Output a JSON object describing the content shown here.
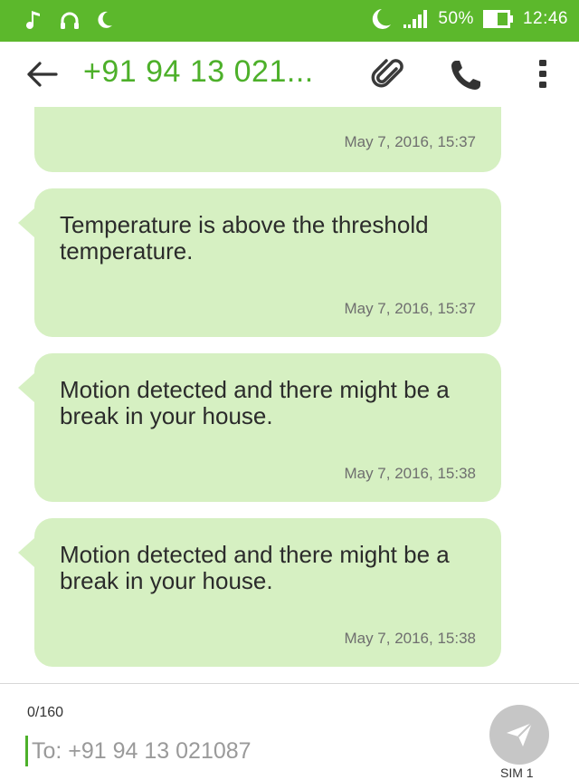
{
  "status_bar": {
    "battery": "50%",
    "time": "12:46",
    "left_icons": [
      "music-note-icon",
      "headphones-icon",
      "moon-icon"
    ],
    "right_icons": [
      "moon-icon",
      "signal-icon",
      "battery-icon"
    ]
  },
  "app_bar": {
    "contact": "+91 94 13 021...",
    "icons": [
      "back-arrow-icon",
      "paperclip-icon",
      "phone-icon",
      "more-vertical-icon"
    ]
  },
  "messages": [
    {
      "text": "",
      "time": "May 7, 2016, 15:37"
    },
    {
      "text": "Temperature is above the threshold temperature.",
      "time": "May 7, 2016, 15:37"
    },
    {
      "text": "Motion detected and there might be a break in your house.",
      "time": "May 7, 2016, 15:38"
    },
    {
      "text": "Motion detected and there might be a break in your house.",
      "time": "May 7, 2016, 15:38"
    }
  ],
  "composer": {
    "counter": "0/160",
    "placeholder": "To: +91 94 13 021087",
    "sim_label": "SIM 1"
  },
  "colors": {
    "accent": "#5cb82c",
    "bubble": "#d6f0c2",
    "send_button": "#c6c6c6"
  }
}
